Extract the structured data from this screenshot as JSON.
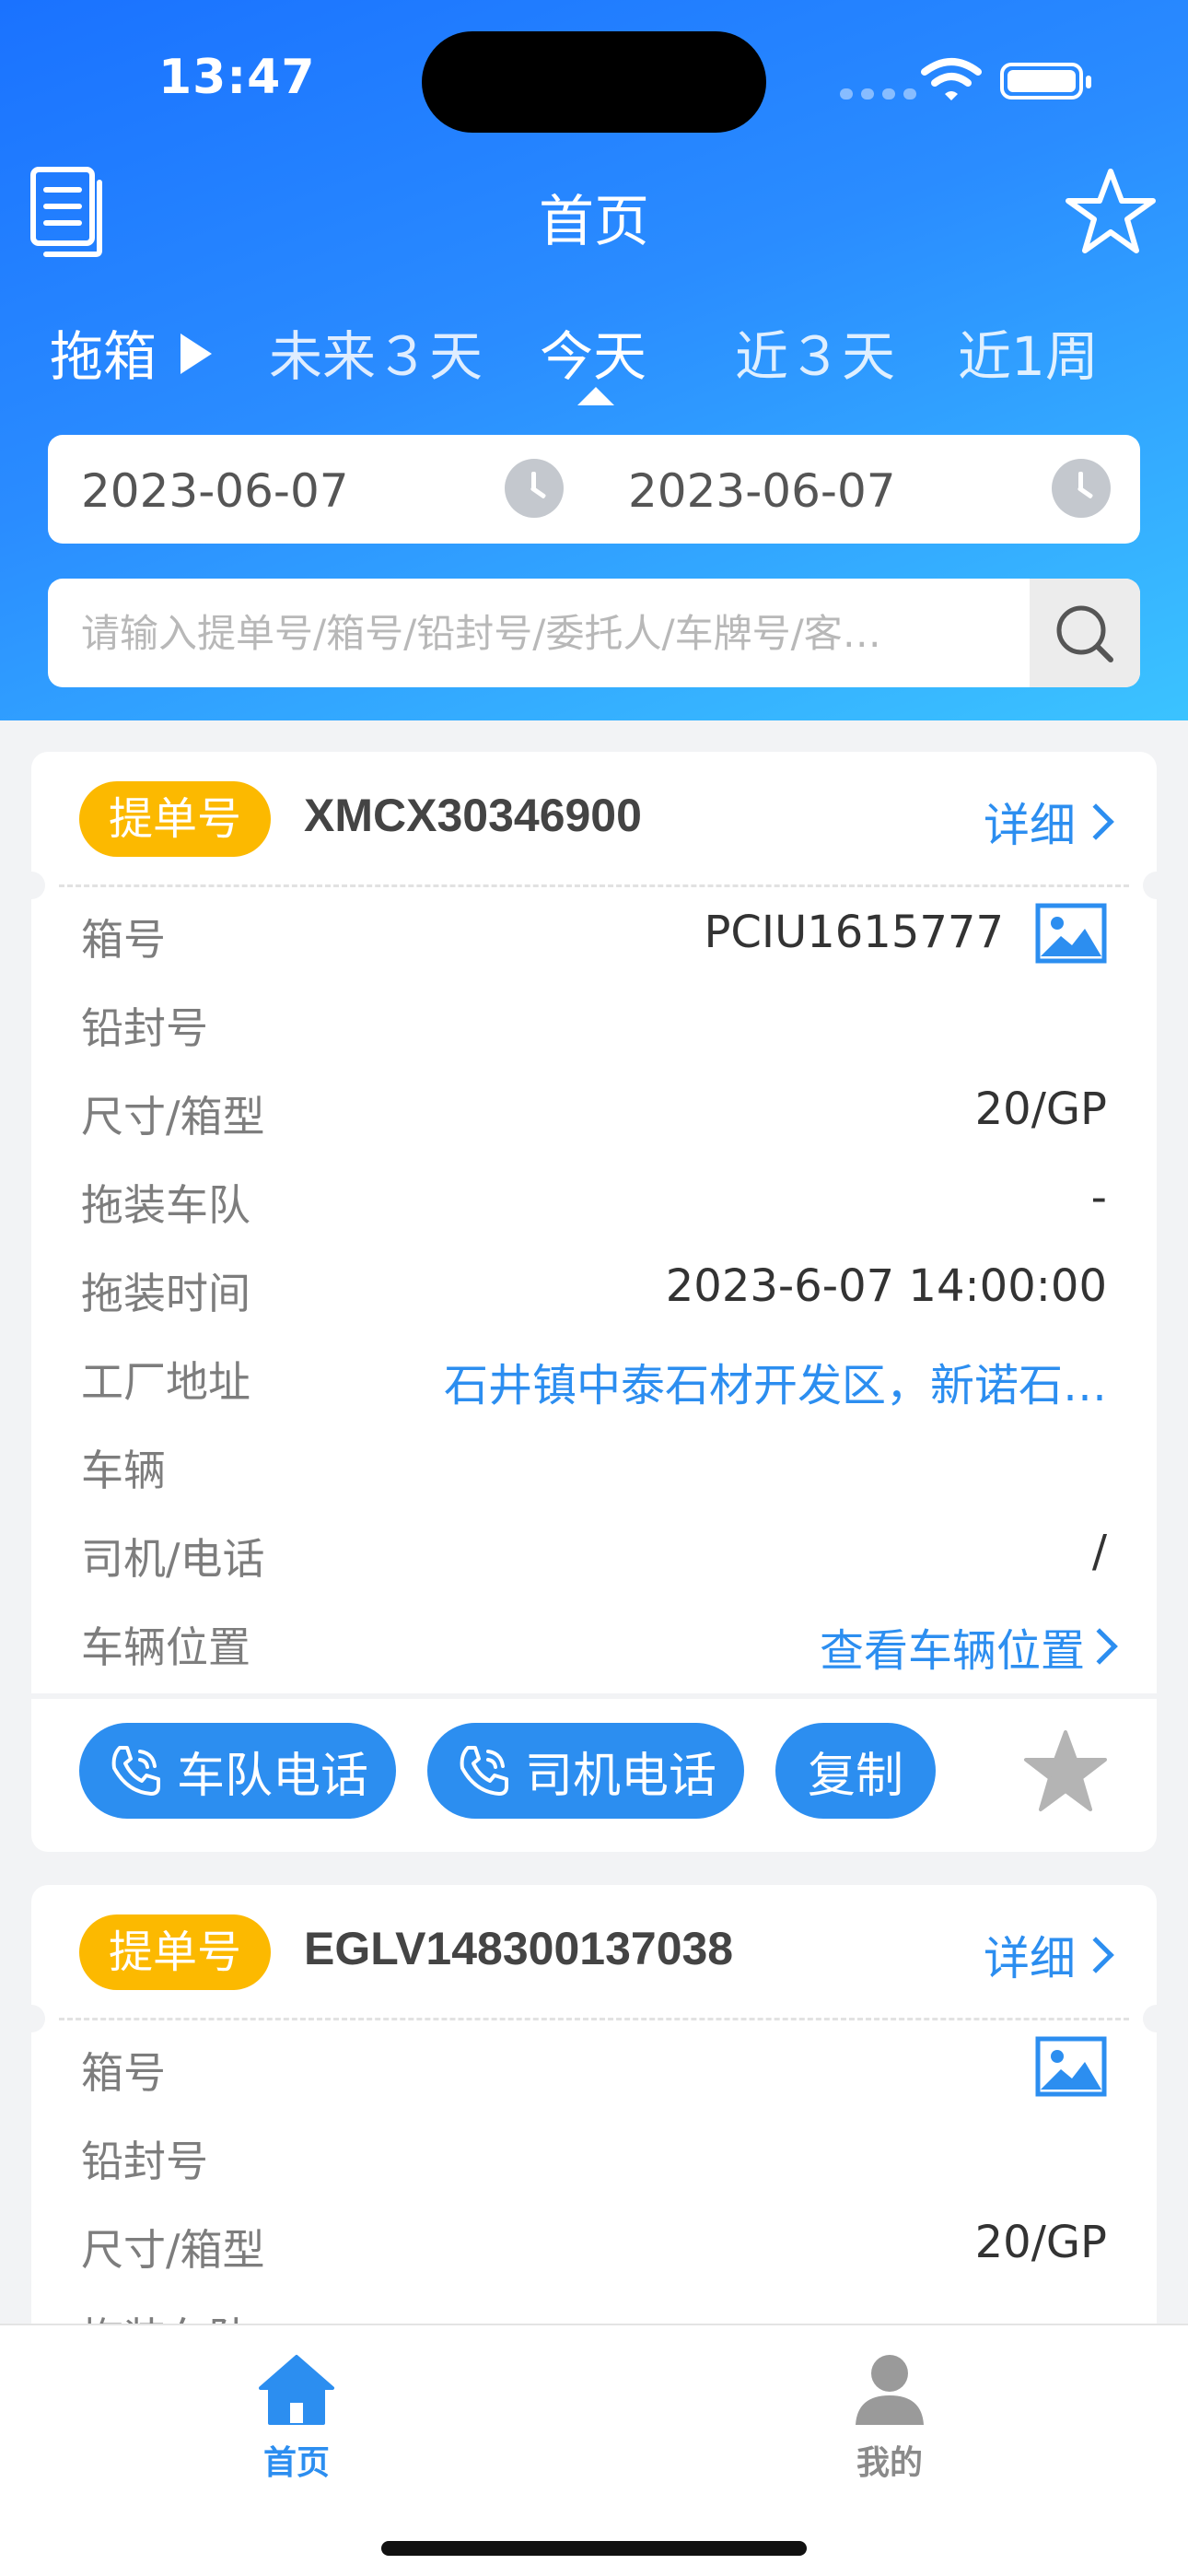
{
  "status_bar": {
    "time": "13:47"
  },
  "nav": {
    "title": "首页"
  },
  "tabs": [
    {
      "label": "拖箱"
    },
    {
      "label": "未来３天"
    },
    {
      "label": "今天"
    },
    {
      "label": "近３天"
    },
    {
      "label": "近1周"
    }
  ],
  "date_range": {
    "start": "2023-06-07",
    "end": "2023-06-07"
  },
  "search": {
    "placeholder": "请输入提单号/箱号/铅封号/委托人/车牌号/客…",
    "value": ""
  },
  "cards": [
    {
      "bl_label": "提单号",
      "bl_number": "XMCX30346900",
      "detail": "详细",
      "rows": [
        {
          "label": "箱号",
          "value": "PCIU1615777"
        },
        {
          "label": "铅封号",
          "value": ""
        },
        {
          "label": "尺寸/箱型",
          "value": "20/GP"
        },
        {
          "label": "拖装车队",
          "value": "-"
        },
        {
          "label": "拖装时间",
          "value": "2023-6-07 14:00:00"
        },
        {
          "label": "工厂地址",
          "value": "石井镇中泰石材开发区，新诺石…"
        },
        {
          "label": "车辆",
          "value": ""
        },
        {
          "label": "司机/电话",
          "value": "/"
        },
        {
          "label": "车辆位置",
          "value": "查看车辆位置"
        }
      ],
      "actions": {
        "fleet_phone": "车队电话",
        "driver_phone": "司机电话",
        "copy": "复制"
      }
    },
    {
      "bl_label": "提单号",
      "bl_number": "EGLV148300137038",
      "detail": "详细",
      "rows": [
        {
          "label": "箱号",
          "value": ""
        },
        {
          "label": "铅封号",
          "value": ""
        },
        {
          "label": "尺寸/箱型",
          "value": "20/GP"
        },
        {
          "label": "拖装车队",
          "value": ""
        }
      ]
    }
  ],
  "bottom_nav": [
    {
      "label": "首页",
      "active": true
    },
    {
      "label": "我的",
      "active": false
    }
  ],
  "colors": {
    "primary": "#2c8ef0",
    "badge": "#fcb900",
    "header_start": "#1a72ff",
    "header_end": "#3bc3ff"
  },
  "icons": [
    "document-icon",
    "star-outline-icon",
    "clock-icon",
    "search-icon",
    "image-icon",
    "phone-icon",
    "star-filled-icon",
    "home-icon",
    "user-icon"
  ]
}
